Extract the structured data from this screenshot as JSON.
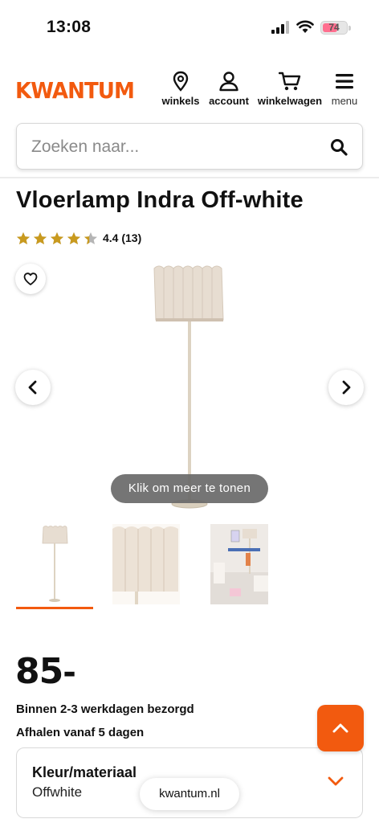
{
  "status_bar": {
    "time": "13:08",
    "battery_level": "74"
  },
  "header": {
    "logo": "KWANTUM",
    "brand_color": "#f25a0f",
    "nav": [
      {
        "label": "winkels",
        "icon": "location-pin-icon"
      },
      {
        "label": "account",
        "icon": "user-icon"
      },
      {
        "label": "winkelwagen",
        "icon": "cart-icon"
      },
      {
        "label": "menu",
        "icon": "hamburger-icon"
      }
    ]
  },
  "search": {
    "placeholder": "Zoeken naar...",
    "value": ""
  },
  "product": {
    "title": "Vloerlamp Indra Off-white",
    "rating": {
      "score": 4.4,
      "count": 13,
      "label": "4.4 (13)",
      "stars_max": 5
    },
    "gallery": {
      "more_button": "Klik om meer te tonen",
      "thumbnails": 3,
      "active_thumbnail": 1
    },
    "price": "85",
    "price_suffix": "-",
    "delivery": "Binnen 2-3 werkdagen bezorgd",
    "pickup": "Afhalen vanaf 5 dagen",
    "variant": {
      "label": "Kleur/materiaal",
      "value": "Offwhite"
    }
  },
  "browser": {
    "url": "kwantum.nl"
  }
}
